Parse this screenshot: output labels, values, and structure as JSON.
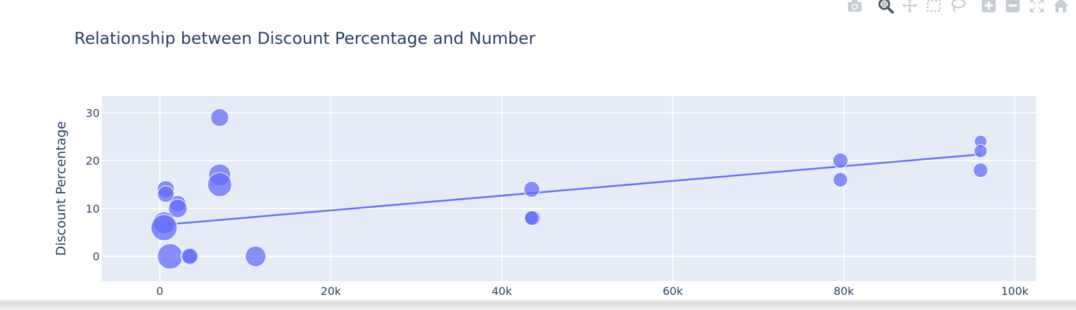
{
  "chart_data": {
    "type": "scatter",
    "title": "Relationship between Discount Percentage and Number",
    "xlabel": "",
    "ylabel": "Discount Percentage",
    "xlim": [
      -6800,
      102500
    ],
    "ylim": [
      -5.2,
      33.5
    ],
    "x_ticks": [
      {
        "value": 0,
        "label": "0"
      },
      {
        "value": 20000,
        "label": "20k"
      },
      {
        "value": 40000,
        "label": "40k"
      },
      {
        "value": 60000,
        "label": "60k"
      },
      {
        "value": 80000,
        "label": "80k"
      },
      {
        "value": 100000,
        "label": "100k"
      }
    ],
    "y_ticks": [
      {
        "value": 0,
        "label": "0"
      },
      {
        "value": 10,
        "label": "10"
      },
      {
        "value": 20,
        "label": "20"
      },
      {
        "value": 30,
        "label": "30"
      }
    ],
    "grid": true,
    "legend": "none",
    "colors": {
      "marker": "#636efa",
      "trendline": "#636efa",
      "plot_bg": "#e5ecf6",
      "grid": "#ffffff",
      "text": "#2a3f5f"
    },
    "points": [
      {
        "x": 7000,
        "y": 29,
        "size": 13.0
      },
      {
        "x": 7000,
        "y": 17,
        "size": 16.0
      },
      {
        "x": 7000,
        "y": 15,
        "size": 17.5
      },
      {
        "x": 2100,
        "y": 11,
        "size": 12.0
      },
      {
        "x": 2100,
        "y": 10,
        "size": 13.5
      },
      {
        "x": 700,
        "y": 14,
        "size": 12.5
      },
      {
        "x": 700,
        "y": 13,
        "size": 12.0
      },
      {
        "x": 500,
        "y": 7,
        "size": 16.0
      },
      {
        "x": 500,
        "y": 6,
        "size": 19.0
      },
      {
        "x": 1200,
        "y": 0,
        "size": 18.5
      },
      {
        "x": 3500,
        "y": 0,
        "size": 13.0
      },
      {
        "x": 3500,
        "y": 0,
        "size": 11.5
      },
      {
        "x": 11200,
        "y": 0,
        "size": 15.0
      },
      {
        "x": 43500,
        "y": 14,
        "size": 11.5
      },
      {
        "x": 43600,
        "y": 8,
        "size": 11.5
      },
      {
        "x": 43500,
        "y": 8,
        "size": 10.5
      },
      {
        "x": 79600,
        "y": 20,
        "size": 11.0
      },
      {
        "x": 79600,
        "y": 16,
        "size": 10.5
      },
      {
        "x": 96000,
        "y": 24,
        "size": 9.0
      },
      {
        "x": 96000,
        "y": 22,
        "size": 9.5
      },
      {
        "x": 96000,
        "y": 18,
        "size": 10.5
      }
    ],
    "trendline": {
      "x": [
        500,
        96000
      ],
      "y": [
        6.6,
        21.3
      ]
    }
  },
  "modebar": {
    "icons": [
      {
        "name": "camera-icon",
        "title": "Download plot as a png"
      },
      {
        "name": "zoom-icon",
        "title": "Zoom"
      },
      {
        "name": "pan-icon",
        "title": "Pan"
      },
      {
        "name": "box-select-icon",
        "title": "Box Select"
      },
      {
        "name": "lasso-select-icon",
        "title": "Lasso Select"
      },
      {
        "name": "zoom-in-icon",
        "title": "Zoom in"
      },
      {
        "name": "zoom-out-icon",
        "title": "Zoom out"
      },
      {
        "name": "autoscale-icon",
        "title": "Autoscale"
      },
      {
        "name": "reset-axes-icon",
        "title": "Reset axes"
      }
    ]
  }
}
